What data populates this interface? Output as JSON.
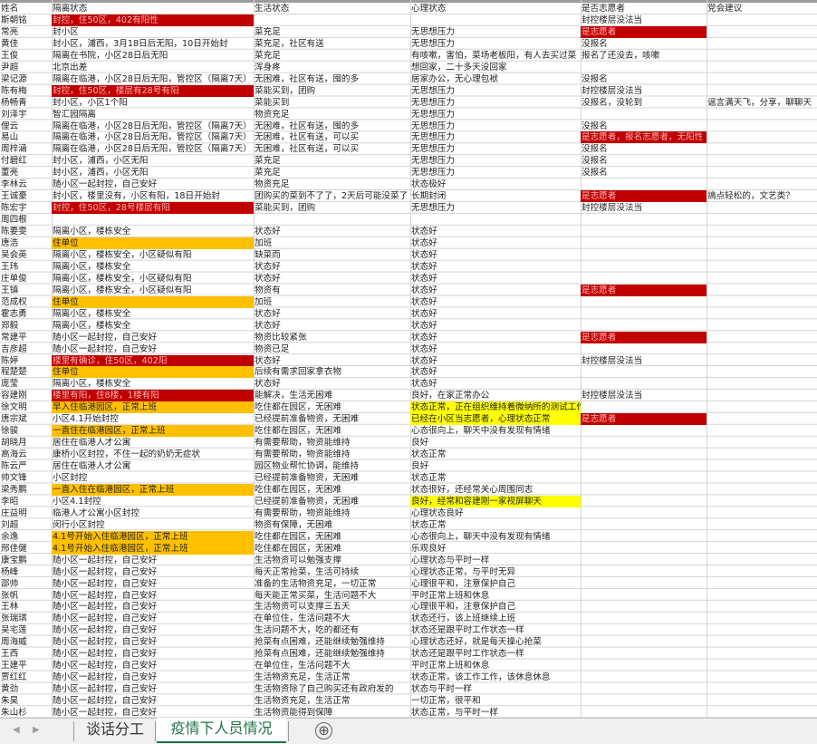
{
  "workbook": {
    "tabs": [
      {
        "label": "谈话分工",
        "active": false
      },
      {
        "label": "疫情下人员情况",
        "active": true
      }
    ],
    "add_sheet_glyph": "⊕",
    "nav_icons": [
      "chevron-left-icon",
      "chevron-right-icon"
    ]
  },
  "colors": {
    "red": "#c00000",
    "orange": "#ffc000",
    "yellow": "#ffff00",
    "active_tab": "#217346"
  },
  "sheet": {
    "columns": [
      "name",
      "quarantine",
      "life",
      "mental",
      "volunteer",
      "party"
    ],
    "rows": [
      [
        {
          "t": "姓名"
        },
        {
          "t": "隔离状态"
        },
        {
          "t": "生活状态"
        },
        {
          "t": "心理状态"
        },
        {
          "t": "是否志愿者"
        },
        {
          "t": "党会建议"
        }
      ],
      [
        {
          "t": "斯朝铭"
        },
        {
          "t": "封控，住50区，402有阳性",
          "f": "red"
        },
        {
          "t": ""
        },
        {
          "t": ""
        },
        {
          "t": "封控楼层没法当"
        },
        {
          "t": ""
        }
      ],
      [
        {
          "t": "常亮"
        },
        {
          "t": "封小区"
        },
        {
          "t": "菜充足"
        },
        {
          "t": "无思想压力"
        },
        {
          "t": "是志愿者",
          "f": "red"
        },
        {
          "t": ""
        }
      ],
      [
        {
          "t": "黄佳"
        },
        {
          "t": "封小区，浦西，3月18日后无阳，10日开始封"
        },
        {
          "t": "菜充足，社区有送"
        },
        {
          "t": "无思想压力"
        },
        {
          "t": "没报名"
        },
        {
          "t": ""
        }
      ],
      [
        {
          "t": "王俊"
        },
        {
          "t": "隔离在书院，小区28日后无阳"
        },
        {
          "t": "菜充足"
        },
        {
          "t": "有咳嗽，害怕，菜场老板阳，有人去买过菜"
        },
        {
          "t": "报名了还没去，咳嗽"
        },
        {
          "t": ""
        }
      ],
      [
        {
          "t": "尹超"
        },
        {
          "t": "北京出差"
        },
        {
          "t": "浑身疼"
        },
        {
          "t": "想回家，二十多天没回家"
        },
        {
          "t": ""
        },
        {
          "t": ""
        }
      ],
      [
        {
          "t": "梁记源"
        },
        {
          "t": "隔离在临港，小区28日后无阳，管控区（隔离7天）"
        },
        {
          "t": "无困难，社区有送，囤的多"
        },
        {
          "t": "居家办公，无心理包袱"
        },
        {
          "t": "没报名"
        },
        {
          "t": ""
        }
      ],
      [
        {
          "t": "陈有梅"
        },
        {
          "t": "封控，住50区，楼层有28号有阳",
          "f": "red"
        },
        {
          "t": "菜能买到，团购"
        },
        {
          "t": "无思想压力"
        },
        {
          "t": "封控楼层没法当"
        },
        {
          "t": ""
        }
      ],
      [
        {
          "t": "杨畅青"
        },
        {
          "t": "封小区，小区1个阳"
        },
        {
          "t": "菜能买到"
        },
        {
          "t": "无思想压力"
        },
        {
          "t": "没报名，没轮到"
        },
        {
          "t": "谣言满天飞，分享，聊聊天"
        }
      ],
      [
        {
          "t": "刘泽宇"
        },
        {
          "t": "智汇园隔离"
        },
        {
          "t": "物资充足"
        },
        {
          "t": "无思想压力"
        },
        {
          "t": ""
        },
        {
          "t": ""
        }
      ],
      [
        {
          "t": "俚云"
        },
        {
          "t": "隔离在临港，小区28日后无阳，管控区（隔离7天）"
        },
        {
          "t": "无困难，社区有送，囤的多"
        },
        {
          "t": "无思想压力"
        },
        {
          "t": "没报名"
        },
        {
          "t": ""
        }
      ],
      [
        {
          "t": "易山"
        },
        {
          "t": "隔离在临港，小区28日后无阳，管控区（隔离7天）"
        },
        {
          "t": "无困难，社区有送，可以买"
        },
        {
          "t": "无思想压力"
        },
        {
          "t": "是志愿者，报名志愿者，无阳性",
          "f": "red"
        },
        {
          "t": ""
        }
      ],
      [
        {
          "t": "周梓涵"
        },
        {
          "t": "隔离在临港，小区28日后无阳，管控区（隔离7天）"
        },
        {
          "t": "无困难，社区有送，可以买"
        },
        {
          "t": "无思想压力"
        },
        {
          "t": "没报名"
        },
        {
          "t": ""
        }
      ],
      [
        {
          "t": "付碧红"
        },
        {
          "t": "封小区，浦西，小区无阳"
        },
        {
          "t": "菜充足"
        },
        {
          "t": "无思想压力"
        },
        {
          "t": "没报名"
        },
        {
          "t": ""
        }
      ],
      [
        {
          "t": "董亮"
        },
        {
          "t": "封小区，浦西，小区无阳"
        },
        {
          "t": "菜充足"
        },
        {
          "t": "无思想压力"
        },
        {
          "t": "没报名"
        },
        {
          "t": ""
        }
      ],
      [
        {
          "t": "李林云"
        },
        {
          "t": "随小区一起封控，自己安好"
        },
        {
          "t": "物资充足"
        },
        {
          "t": "状态极好"
        },
        {
          "t": ""
        },
        {
          "t": ""
        }
      ],
      [
        {
          "t": "王诚豪"
        },
        {
          "t": "封小区，楼里没有，小区有阳，18日开始封"
        },
        {
          "t": "团购买的菜到不了了，2天后可能没菜了"
        },
        {
          "t": "长期封闭"
        },
        {
          "t": "是志愿者",
          "f": "red"
        },
        {
          "t": "搞点轻松的，文艺类？"
        }
      ],
      [
        {
          "t": "陈宏宇"
        },
        {
          "t": "封控，住50区，28号楼层有阳",
          "f": "red"
        },
        {
          "t": "菜能买到，团购"
        },
        {
          "t": "无思想压力"
        },
        {
          "t": "封控楼层没法当"
        },
        {
          "t": ""
        }
      ],
      [
        {
          "t": "周四根"
        },
        {
          "t": ""
        },
        {
          "t": ""
        },
        {
          "t": ""
        },
        {
          "t": ""
        },
        {
          "t": ""
        }
      ],
      [
        {
          "t": "陈要雯"
        },
        {
          "t": "隔离小区，楼栋安全"
        },
        {
          "t": "状态好"
        },
        {
          "t": "状态好"
        },
        {
          "t": ""
        },
        {
          "t": ""
        }
      ],
      [
        {
          "t": "唐浩"
        },
        {
          "t": "住单位",
          "f": "orange"
        },
        {
          "t": "加班"
        },
        {
          "t": "状态好"
        },
        {
          "t": ""
        },
        {
          "t": ""
        }
      ],
      [
        {
          "t": "吴会英"
        },
        {
          "t": "隔离小区，楼栋安全，小区疑似有阳"
        },
        {
          "t": "缺菜而"
        },
        {
          "t": "状态好"
        },
        {
          "t": ""
        },
        {
          "t": ""
        }
      ],
      [
        {
          "t": "王玮"
        },
        {
          "t": "隔离小区，楼栋安全"
        },
        {
          "t": "状态好"
        },
        {
          "t": "状态好"
        },
        {
          "t": ""
        },
        {
          "t": ""
        }
      ],
      [
        {
          "t": "庄单俊"
        },
        {
          "t": "隔离小区，楼栋安全，小区疑似有阳"
        },
        {
          "t": "状态好"
        },
        {
          "t": "状态好"
        },
        {
          "t": ""
        },
        {
          "t": ""
        }
      ],
      [
        {
          "t": "王镇"
        },
        {
          "t": "隔离小区，楼栋安全，小区疑似有阳"
        },
        {
          "t": "物资有"
        },
        {
          "t": "状态好"
        },
        {
          "t": "是志愿者",
          "f": "red"
        },
        {
          "t": ""
        }
      ],
      [
        {
          "t": "范成权"
        },
        {
          "t": "住单位",
          "f": "orange"
        },
        {
          "t": "加班"
        },
        {
          "t": "状态好"
        },
        {
          "t": ""
        },
        {
          "t": ""
        }
      ],
      [
        {
          "t": "霍志勇"
        },
        {
          "t": "隔离小区，楼栋安全"
        },
        {
          "t": "状态好"
        },
        {
          "t": "状态好"
        },
        {
          "t": ""
        },
        {
          "t": ""
        }
      ],
      [
        {
          "t": "郑毅"
        },
        {
          "t": "隔离小区，楼栋安全"
        },
        {
          "t": "状态好"
        },
        {
          "t": "状态好"
        },
        {
          "t": ""
        },
        {
          "t": ""
        }
      ],
      [
        {
          "t": "常建平"
        },
        {
          "t": "随小区一起封控，自己安好"
        },
        {
          "t": "物资比较紧张"
        },
        {
          "t": "状态好"
        },
        {
          "t": "是志愿者",
          "f": "red"
        },
        {
          "t": ""
        }
      ],
      [
        {
          "t": "吉彦超"
        },
        {
          "t": "随小区一起封控，自己安好"
        },
        {
          "t": "物资已足"
        },
        {
          "t": "状态好"
        },
        {
          "t": ""
        },
        {
          "t": ""
        }
      ],
      [
        {
          "t": "陈婷"
        },
        {
          "t": "楼里有确诊，住50区，402阳",
          "f": "red"
        },
        {
          "t": "状态好"
        },
        {
          "t": "状态好"
        },
        {
          "t": "封控楼层没法当"
        },
        {
          "t": ""
        }
      ],
      [
        {
          "t": "程楚楚"
        },
        {
          "t": "住单位",
          "f": "orange"
        },
        {
          "t": "后续有需求回家拿衣物"
        },
        {
          "t": "状态好"
        },
        {
          "t": ""
        },
        {
          "t": ""
        }
      ],
      [
        {
          "t": "庞莹"
        },
        {
          "t": "隔离小区，楼栋安全"
        },
        {
          "t": "状态好"
        },
        {
          "t": "状态好"
        },
        {
          "t": ""
        },
        {
          "t": ""
        }
      ],
      [
        {
          "t": "容建刚"
        },
        {
          "t": "楼里有阳，住8楼，1楼有阳",
          "f": "red"
        },
        {
          "t": "能解决，生活无困难"
        },
        {
          "t": "良好，在家正常办公"
        },
        {
          "t": "封控楼层没法当"
        },
        {
          "t": ""
        }
      ],
      [
        {
          "t": "徐文明"
        },
        {
          "t": "早入住临港园区，正常上班",
          "f": "orange"
        },
        {
          "t": "吃住都在园区，无困难"
        },
        {
          "t": "状态正常，正在组织维持着微纳所的测试工作",
          "f": "yellow"
        },
        {
          "t": ""
        },
        {
          "t": ""
        }
      ],
      [
        {
          "t": "唐宗斌"
        },
        {
          "t": "小区4.1开始封控"
        },
        {
          "t": "已经提前准备物资，无困难"
        },
        {
          "t": "已经在小区当志愿者，心理状态正常",
          "f": "yellow"
        },
        {
          "t": "是志愿者",
          "f": "red"
        },
        {
          "t": ""
        }
      ],
      [
        {
          "t": "徐骏"
        },
        {
          "t": "一直住在临港园区，正常上班",
          "f": "orange"
        },
        {
          "t": "吃住都在园区，无困难"
        },
        {
          "t": "心态很向上，聊天中没有发现有情绪"
        },
        {
          "t": ""
        },
        {
          "t": ""
        }
      ],
      [
        {
          "t": "胡晓月"
        },
        {
          "t": "居住在临港人才公寓"
        },
        {
          "t": "有需要帮助，物资能维持"
        },
        {
          "t": "良好"
        },
        {
          "t": ""
        },
        {
          "t": ""
        }
      ],
      [
        {
          "t": "高海云"
        },
        {
          "t": "康桥小区封控，不住一起的奶奶无症状"
        },
        {
          "t": "有需要帮助，物资能维持"
        },
        {
          "t": "状态正常"
        },
        {
          "t": ""
        },
        {
          "t": ""
        }
      ],
      [
        {
          "t": "陈云严"
        },
        {
          "t": "居住在临港人才公寓"
        },
        {
          "t": "园区物业帮忙协调，能维持"
        },
        {
          "t": "良好"
        },
        {
          "t": ""
        },
        {
          "t": ""
        }
      ],
      [
        {
          "t": "帅文锋"
        },
        {
          "t": "小区封控"
        },
        {
          "t": "已经提前准备物资，无困难"
        },
        {
          "t": "状态正常"
        },
        {
          "t": ""
        },
        {
          "t": ""
        }
      ],
      [
        {
          "t": "梁秀鹏"
        },
        {
          "t": "一直入住在临港园区，正常上班",
          "f": "orange"
        },
        {
          "t": "吃住都在园区，无困难"
        },
        {
          "t": "状态很好，还经常关心周围同志"
        },
        {
          "t": ""
        },
        {
          "t": ""
        }
      ],
      [
        {
          "t": "李昭"
        },
        {
          "t": "小区4.1封控"
        },
        {
          "t": "已经提前准备物资，无困难"
        },
        {
          "t": "良好，经常和容建刚一家视屏聊天",
          "f": "yellow"
        },
        {
          "t": ""
        },
        {
          "t": ""
        }
      ],
      [
        {
          "t": "庄益明"
        },
        {
          "t": "临港人才公寓小区封控"
        },
        {
          "t": "有需要帮助，物资能维持"
        },
        {
          "t": "心理状态良好"
        },
        {
          "t": ""
        },
        {
          "t": ""
        }
      ],
      [
        {
          "t": "刘超"
        },
        {
          "t": "闵行小区封控"
        },
        {
          "t": "物资有保障，无困难"
        },
        {
          "t": "状态正常"
        },
        {
          "t": ""
        },
        {
          "t": ""
        }
      ],
      [
        {
          "t": "余逸"
        },
        {
          "t": "4.1号开始入住临港园区，正常上班",
          "f": "orange"
        },
        {
          "t": "吃住都在园区，无困难"
        },
        {
          "t": "心态很向上，聊天中没有发现有情绪"
        },
        {
          "t": ""
        },
        {
          "t": ""
        }
      ],
      [
        {
          "t": "邢佳健"
        },
        {
          "t": "4.1号开始入住临港园区，正常上班",
          "f": "orange"
        },
        {
          "t": "吃住都在园区，无困难"
        },
        {
          "t": "乐观良好"
        },
        {
          "t": ""
        },
        {
          "t": ""
        }
      ],
      [
        {
          "t": "康宝鹏"
        },
        {
          "t": "随小区一起封控，自己安好"
        },
        {
          "t": "生活物资可以勉强支撑"
        },
        {
          "t": "心理状态与平时一样"
        },
        {
          "t": ""
        },
        {
          "t": ""
        }
      ],
      [
        {
          "t": "杨峰"
        },
        {
          "t": "随小区一起封控，自己安好"
        },
        {
          "t": "每天正常抢菜，生活可持续"
        },
        {
          "t": "心理状态正常，与平时无异"
        },
        {
          "t": ""
        },
        {
          "t": ""
        }
      ],
      [
        {
          "t": "邵帅"
        },
        {
          "t": "随小区一起封控，自己安好"
        },
        {
          "t": "准备的生活物资充足，一切正常"
        },
        {
          "t": "心理很平和，注意保护自己"
        },
        {
          "t": ""
        },
        {
          "t": ""
        }
      ],
      [
        {
          "t": "张帆"
        },
        {
          "t": "随小区一起封控，自己安好"
        },
        {
          "t": "每天能正常买菜，生活问题不大"
        },
        {
          "t": "平时正常上班和休息"
        },
        {
          "t": ""
        },
        {
          "t": ""
        }
      ],
      [
        {
          "t": "王林"
        },
        {
          "t": "随小区一起封控，自己安好"
        },
        {
          "t": "生活物资可以支撑三五天"
        },
        {
          "t": "心理很平和，注意保护自己"
        },
        {
          "t": ""
        },
        {
          "t": ""
        }
      ],
      [
        {
          "t": "张瑞琪"
        },
        {
          "t": "随小区一起封控，自己安好"
        },
        {
          "t": "在单位住，生活问题不大"
        },
        {
          "t": "状态还行，该上班继续上班"
        },
        {
          "t": ""
        },
        {
          "t": ""
        }
      ],
      [
        {
          "t": "吴宅莲"
        },
        {
          "t": "随小区一起封控，自己安好"
        },
        {
          "t": "生活问题不大，吃的都还有"
        },
        {
          "t": "状态还是跟平时工作状态一样"
        },
        {
          "t": ""
        },
        {
          "t": ""
        }
      ],
      [
        {
          "t": "周海威"
        },
        {
          "t": "随小区一起封控，自己安好"
        },
        {
          "t": "抢菜有点困难，还能继续勉强维持"
        },
        {
          "t": "心理状态还好，就是每天操心抢菜"
        },
        {
          "t": ""
        },
        {
          "t": ""
        }
      ],
      [
        {
          "t": "王西"
        },
        {
          "t": "随小区一起封控，自己安好"
        },
        {
          "t": "抢菜有点困难，还能继续勉强维持"
        },
        {
          "t": "状态还是跟平时工作状态一样"
        },
        {
          "t": ""
        },
        {
          "t": ""
        }
      ],
      [
        {
          "t": "王建平"
        },
        {
          "t": "随小区一起封控，自己安好"
        },
        {
          "t": "在单位住，生活问题不大"
        },
        {
          "t": "平时正常上班和休息"
        },
        {
          "t": ""
        },
        {
          "t": ""
        }
      ],
      [
        {
          "t": "贾红红"
        },
        {
          "t": "随小区一起封控，自己安好"
        },
        {
          "t": "生活物资充足，生活正常"
        },
        {
          "t": "状态正常，该工作工作，该休息休息"
        },
        {
          "t": ""
        },
        {
          "t": ""
        }
      ],
      [
        {
          "t": "黄劲"
        },
        {
          "t": "随小区一起封控，自己安好"
        },
        {
          "t": "生活物资除了自己购买还有政府发的"
        },
        {
          "t": "状态与平时一样"
        },
        {
          "t": ""
        },
        {
          "t": ""
        }
      ],
      [
        {
          "t": "朱昊"
        },
        {
          "t": "随小区一起封控，自己安好"
        },
        {
          "t": "生活物资充足，生活正常"
        },
        {
          "t": "一切正常，很平和"
        },
        {
          "t": ""
        },
        {
          "t": ""
        }
      ],
      [
        {
          "t": "朱山杉"
        },
        {
          "t": "随小区一起封控，自己安好"
        },
        {
          "t": "生活物资能得到保障"
        },
        {
          "t": "状态正常，与平时一样"
        },
        {
          "t": ""
        },
        {
          "t": ""
        }
      ]
    ]
  }
}
